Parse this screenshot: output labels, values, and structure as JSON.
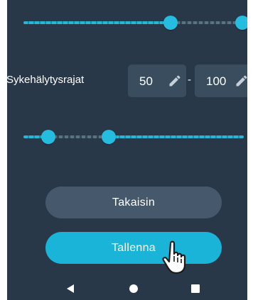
{
  "hr_limits": {
    "label": "Sykehälytysrajat",
    "min_value": "50",
    "separator": "-",
    "max_value": "100"
  },
  "top_slider": {
    "lower": 0.67,
    "upper": 1.0
  },
  "hr_slider": {
    "lower": 0.11,
    "upper": 0.39
  },
  "buttons": {
    "back_label": "Takaisin",
    "save_label": "Tallenna"
  },
  "icons": {
    "edit": "pencil-icon",
    "nav_back": "triangle-left-icon",
    "nav_home": "circle-icon",
    "nav_recents": "square-icon",
    "pointer": "hand-pointer-icon"
  },
  "colors": {
    "background": "#293848",
    "accent": "#19b4d8",
    "field": "#3a4d5f",
    "secondary_button": "#46596c"
  }
}
